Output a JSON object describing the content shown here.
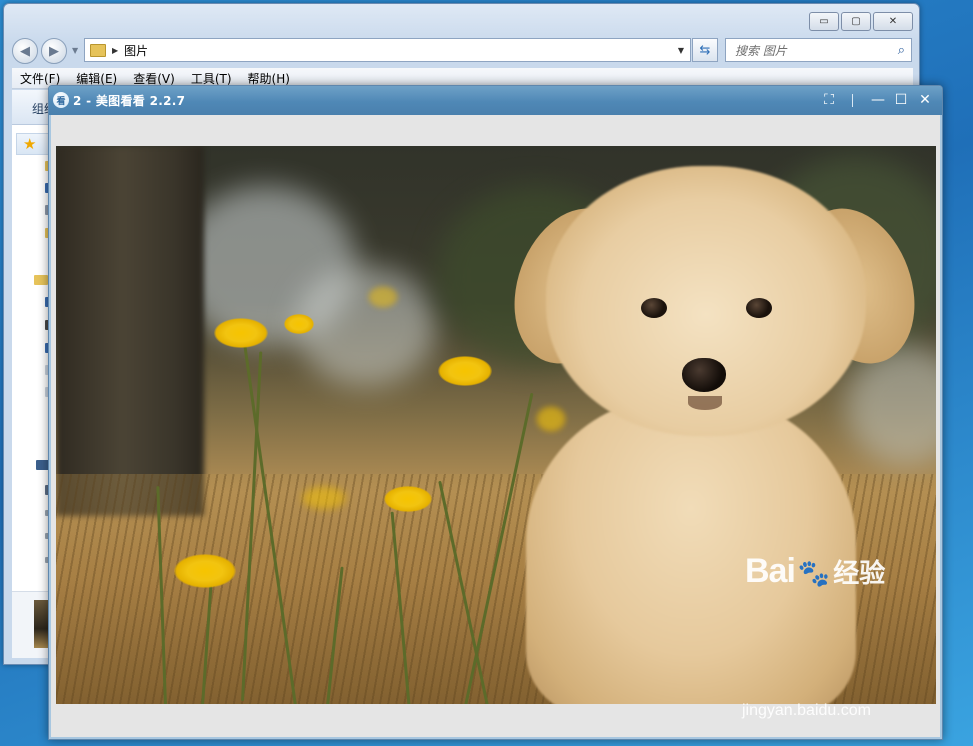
{
  "explorer": {
    "caption_buttons": {
      "minimize": "▭",
      "maximize": "▢",
      "close": "✕"
    },
    "address_text": "图片",
    "search_placeholder": "搜索 图片",
    "menu": [
      "文件(F)",
      "编辑(E)",
      "查看(V)",
      "工具(T)",
      "帮助(H)"
    ],
    "toolbar_organize": "组织"
  },
  "viewer": {
    "title": "2 - 美图看看 2.2.7",
    "app_icon_glyph": "看",
    "controls": {
      "fullscreen": "⛶",
      "minimize": "—",
      "maximize": "☐",
      "close": "✕"
    }
  },
  "photo": {
    "subject": "puppy-among-yellow-flowers"
  },
  "watermark": {
    "brand_prefix": "Bai",
    "brand_paw": "🐾",
    "brand_suffix": "经验",
    "url": "jingyan.baidu.com"
  },
  "colors": {
    "desktop": "#2a7ec8",
    "viewer_title": "#5a90bd",
    "viewer_bg": "#e5e5e5",
    "explorer_chrome": "#c9d9ec"
  }
}
